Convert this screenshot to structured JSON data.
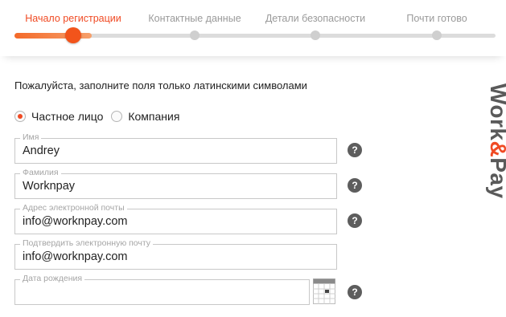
{
  "stepper": {
    "steps": [
      {
        "label": "Начало регистрации",
        "active": true
      },
      {
        "label": "Контактные данные",
        "active": false
      },
      {
        "label": "Детали безопасности",
        "active": false
      },
      {
        "label": "Почти готово",
        "active": false
      }
    ]
  },
  "form": {
    "instructions": "Пожалуйста, заполните поля только латинскими символами",
    "account_type": {
      "options": [
        "Частное лицо",
        "Компания"
      ],
      "selected": "Частное лицо"
    },
    "fields": [
      {
        "label": "Имя",
        "value": "Andrey"
      },
      {
        "label": "Фамилия",
        "value": "Worknpay"
      },
      {
        "label": "Адрес электронной почты",
        "value": "info@worknpay.com"
      },
      {
        "label": "Подтвердить электронную почту",
        "value": "info@worknpay.com"
      },
      {
        "label": "Дата рождения",
        "value": ""
      }
    ],
    "help_symbol": "?"
  },
  "brand": {
    "logo_part1": "Work",
    "logo_amp": "&",
    "logo_part2": "Pay",
    "accent_color": "#f04a23"
  }
}
